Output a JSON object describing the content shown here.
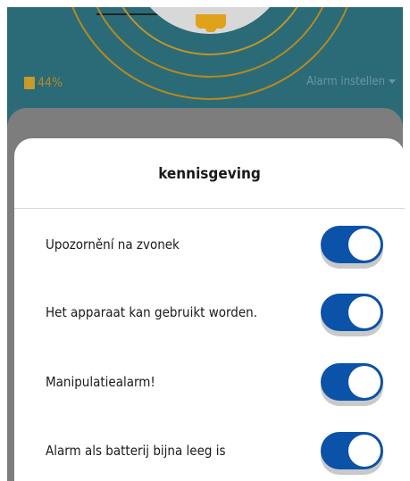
{
  "background": {
    "battery_text": "44%",
    "alarm_settings_label": "Alarm instellen"
  },
  "dialog": {
    "title": "kennisgeving",
    "items": [
      {
        "label": "Upozornění na zvonek",
        "enabled": true
      },
      {
        "label": "Het apparaat kan gebruikt worden.",
        "enabled": true
      },
      {
        "label": "Manipulatiealarm!",
        "enabled": true
      },
      {
        "label": "Alarm als batterij bijna leeg is",
        "enabled": true
      }
    ]
  },
  "colors": {
    "toggle_on": "#0b52a9",
    "background_teal": "#2a6b77",
    "accent_gold": "#b7891f"
  }
}
